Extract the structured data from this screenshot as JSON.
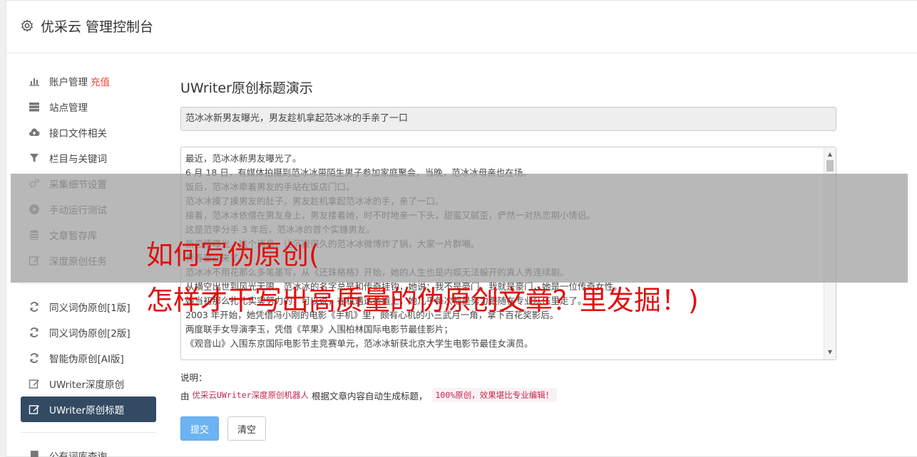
{
  "header": {
    "title": "优采云 管理控制台",
    "icon": "gear-icon"
  },
  "sidebar": {
    "group1": [
      {
        "label": "账户管理",
        "badge": "充值",
        "icon": "bar-chart-icon"
      },
      {
        "label": "站点管理",
        "icon": "server-icon"
      },
      {
        "label": "接口文件相关",
        "icon": "cloud-upload-icon"
      },
      {
        "label": "栏目与关键词",
        "icon": "filter-icon"
      },
      {
        "label": "采集细节设置",
        "icon": "cogs-icon"
      },
      {
        "label": "手动运行测试",
        "icon": "play-circle-icon"
      },
      {
        "label": "文章暂存库",
        "icon": "database-icon"
      },
      {
        "label": "深度原创任务",
        "icon": "edit-icon"
      }
    ],
    "group2": [
      {
        "label": "同义词伪原创[1版]",
        "icon": "refresh-icon"
      },
      {
        "label": "同义词伪原创[2版]",
        "icon": "refresh-icon"
      },
      {
        "label": "智能伪原创[AI版]",
        "icon": "refresh-icon"
      },
      {
        "label": "UWriter深度原创",
        "icon": "edit-icon"
      },
      {
        "label": "UWriter原创标题",
        "icon": "edit-icon",
        "active": true
      }
    ],
    "group3": [
      {
        "label": "公有词库查询",
        "icon": "book-icon"
      }
    ]
  },
  "main": {
    "heading": "UWriter原创标题演示",
    "title_value": "范冰冰新男友曝光，男友趁机拿起范冰冰的手亲了一口",
    "content_lines": [
      "最近，范冰冰新男友曝光了。",
      "6 月 18 日，有媒体拍摄到范冰冰带陌生男子参加家庭聚会，当晚，范冰冰母亲也在场。",
      "饭后，范冰冰牵着男友的手站在饭店门口。",
      "范冰冰摸了摸男友的肚子，男友趁机拿起范冰冰的手，亲了一口。",
      "接着，范冰冰依偎在男友身上，男友搂着她，时不时地亲一下头，甜蜜又腻歪，俨然一对热恋期小情侣。",
      "这是范李分手 3 年后，范冰冰的首个实锤男友。",
      "新恋情曝光，这个消息，让沉寂很久的范冰冰微博炸了锅，大家一片群嘲。",
      "青春要回来了",
      "范冰冰不用花那么多笔墨写，从《还珠格格》开始，她的人生也是内娱无法躲开的真人秀连续剧。",
      "从横空出世到风光无限，范冰冰的名字总是和传奇挂钩，她说：我不是豪门，我就是豪门，她是一位传奇女性。",
      "她当初那么扎扎实实努力的，可以说，在机遇这条道上，她几乎每次都是努力跟随在专业队伍里走了。",
      "2003 年开始，她凭借冯小刚的电影《手机》里，颇有心机的小三武月一角，拿下百花奖影后。",
      "两度联手女导演李玉，凭借《苹果》入围柏林国际电影节最佳影片；",
      "《观音山》入围东京国际电影节主竞赛单元，范冰冰斩获北京大学生电影节最佳女演员。"
    ],
    "note_title": "说明：",
    "note_prefix": "由",
    "note_code": "优采云UWriter深度原创机器人",
    "note_middle": "根据文章内容自动生成标题，",
    "note_pill": "100%原创，效果堪比专业编辑！",
    "submit_label": "提交",
    "clear_label": "清空"
  },
  "overlay": {
    "line1": "如何写伪原创(",
    "line2": "怎样才干写出高质量的伪原创文章？里发掘！)"
  }
}
